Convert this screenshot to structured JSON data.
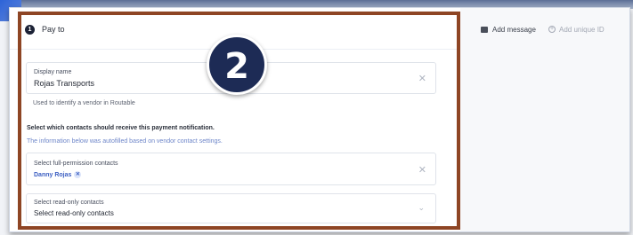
{
  "form": {
    "step_number": "1",
    "title": "Pay to",
    "display_name": {
      "label": "Display name",
      "value": "Rojas Transports",
      "helper": "Used to identify a vendor in Routable"
    },
    "contacts_heading": "Select which contacts should receive this payment notification.",
    "autofill_note": "The information below was autofilled based on vendor contact settings.",
    "full_permission": {
      "label": "Select full-permission contacts",
      "chips": [
        "Danny Rojas"
      ]
    },
    "read_only": {
      "label": "Select read-only contacts",
      "placeholder": "Select read-only contacts"
    }
  },
  "side_actions": {
    "add_message": "Add message",
    "add_unique_id": "Add unique ID"
  },
  "annotation": {
    "badge_number": "2",
    "frame_color": "#8e4524",
    "badge_color": "#1d2b55"
  },
  "icons": {
    "step": "step-number-icon",
    "clear": "close-icon",
    "chevron": "chevron-down-icon",
    "message": "message-icon",
    "add": "plus-circle-icon"
  }
}
